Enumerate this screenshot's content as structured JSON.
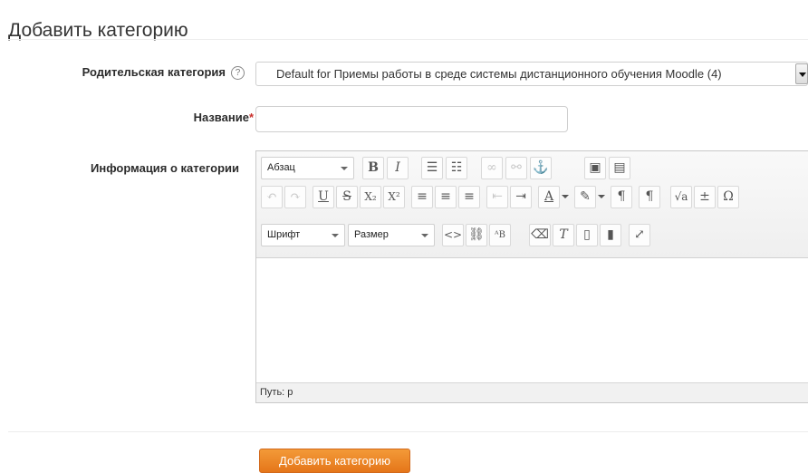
{
  "page": {
    "title": "Добавить категорию"
  },
  "form": {
    "parent_label": "Родительская категория",
    "parent_value": "Default for Приемы работы в среде системы дистанционного обучения Moodle (4)",
    "name_label": "Название",
    "required_mark": "*",
    "name_value": "",
    "info_label": "Информация о категории",
    "help_glyph": "?"
  },
  "editor": {
    "paragraph_format": "Абзац",
    "font_family": "Шрифт",
    "font_size": "Размер",
    "status_path": "Путь: p",
    "row1_icons": [
      "bold-icon",
      "italic-icon",
      "bullet-list-icon",
      "numbered-list-icon",
      "link-icon",
      "unlink-icon",
      "anchor-icon",
      "image-icon",
      "media-icon"
    ],
    "row2_icons": [
      "undo-icon",
      "redo-icon",
      "underline-icon",
      "strikethrough-icon",
      "subscript-icon",
      "superscript-icon",
      "align-left-icon",
      "align-center-icon",
      "align-right-icon",
      "outdent-icon",
      "indent-icon",
      "text-color-icon",
      "background-color-icon",
      "ltr-icon",
      "rtl-icon",
      "equation-icon",
      "character-map-icon",
      "special-chars-icon"
    ],
    "row3_icons": [
      "html-icon",
      "find-icon",
      "replace-icon",
      "clear-formatting-icon",
      "remove-format-icon",
      "paste-text-icon",
      "paste-word-icon",
      "fullscreen-icon"
    ]
  },
  "actions": {
    "submit_label": "Добавить категорию"
  },
  "colors": {
    "accent": "#f0892b",
    "required": "#c9302c"
  }
}
